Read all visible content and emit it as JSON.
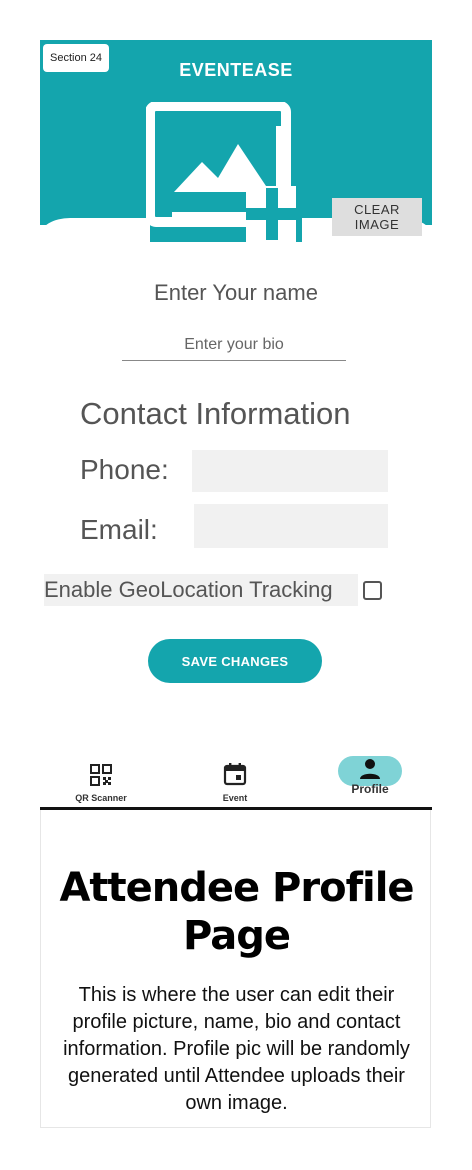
{
  "section_tag": "Section 24",
  "app": {
    "title": "EVENTEASE",
    "clear_image_label": "CLEAR IMAGE",
    "name_placeholder": "Enter Your name",
    "bio_placeholder": "Enter your bio",
    "contact_heading": "Contact Information",
    "phone_label": "Phone:",
    "phone_value": "",
    "email_label": "Email:",
    "email_value": "",
    "geolocation_label": "Enable GeoLocation Tracking",
    "geolocation_checked": false,
    "save_label": "SAVE CHANGES",
    "accent_color": "#14a5ad",
    "profile_image_icon": "add-photo-icon"
  },
  "nav": {
    "items": [
      {
        "label": "QR Scanner",
        "icon": "qr-code-icon",
        "active": false
      },
      {
        "label": "Event",
        "icon": "calendar-icon",
        "active": false
      },
      {
        "label": "Profile",
        "icon": "person-icon",
        "active": true
      }
    ]
  },
  "description": {
    "title": "Attendee Profile Page",
    "body": "This is where the user can edit their profile picture, name, bio and contact information. Profile pic will be randomly generated until Attendee uploads their own image."
  }
}
